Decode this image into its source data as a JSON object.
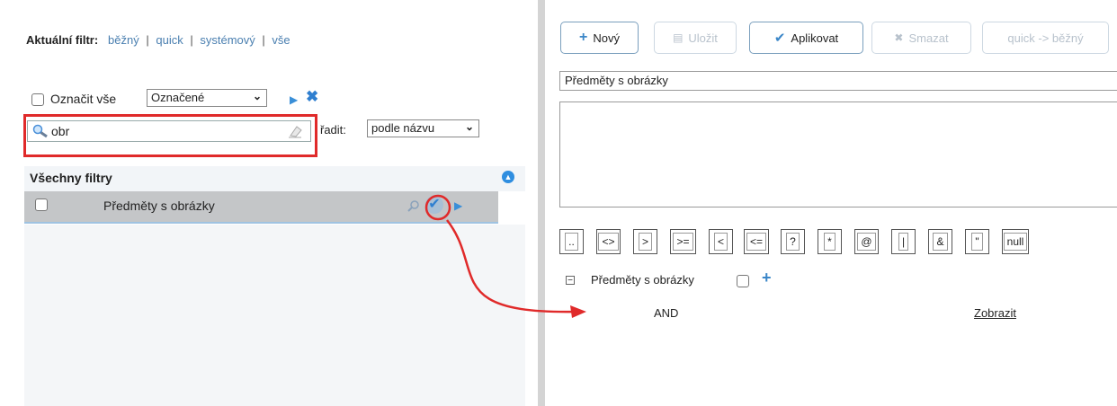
{
  "filter_bar": {
    "label": "Aktuální filtr:",
    "options": [
      "běžný",
      "quick",
      "systémový",
      "vše"
    ],
    "separator": "|"
  },
  "selection": {
    "select_all_label": "Označit vše",
    "marked_select_value": "Označené"
  },
  "search": {
    "value": "obr",
    "sort_label": "řadit:",
    "sort_value": "podle názvu"
  },
  "list": {
    "header": "Všechny filtry",
    "rows": [
      {
        "label": "Předměty s obrázky"
      }
    ]
  },
  "toolbar": {
    "new_label": "Nový",
    "save_label": "Uložit",
    "apply_label": "Aplikovat",
    "delete_label": "Smazat",
    "convert_label": "quick -> běžný"
  },
  "editor": {
    "name_value": "Předměty s obrázky",
    "operators": [
      "..",
      "<>",
      ">",
      ">=",
      "<",
      "<=",
      "?",
      "*",
      "@",
      "|",
      "&",
      "\"",
      "null"
    ],
    "tree_label": "Předměty s obrázky",
    "and_label": "AND",
    "show_link": "Zobrazit"
  },
  "colors": {
    "highlight_red": "#e02a2a",
    "accent_blue": "#3a8fd8",
    "row_bg": "#c4c6c8"
  }
}
